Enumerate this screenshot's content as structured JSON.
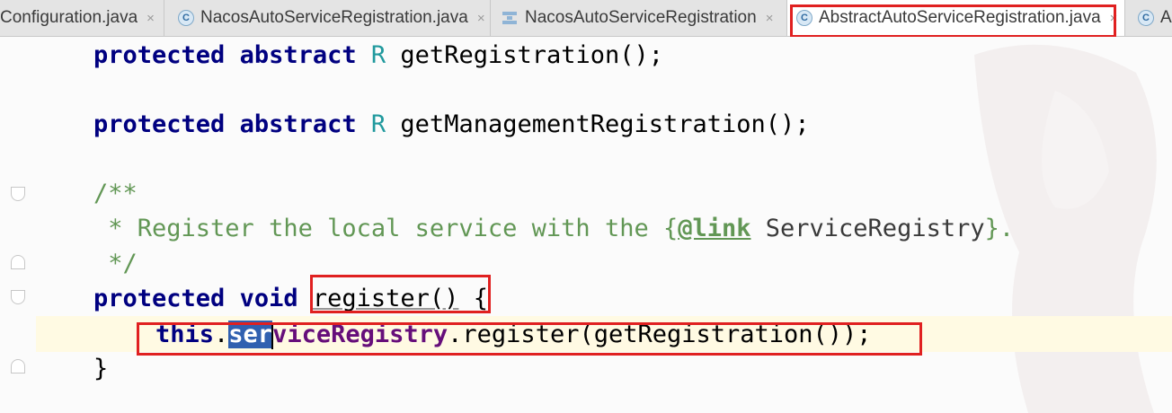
{
  "tabs": [
    {
      "label": "Configuration.java",
      "icon": "class-icon",
      "active": false
    },
    {
      "label": "NacosAutoServiceRegistration.java",
      "icon": "class-icon",
      "active": false
    },
    {
      "label": "NacosAutoServiceRegistration",
      "icon": "diagram-icon",
      "active": false
    },
    {
      "label": "AbstractAutoServiceRegistration.java",
      "icon": "class-icon",
      "active": true
    },
    {
      "label": "A",
      "icon": "class-icon",
      "active": false
    }
  ],
  "tab_close_glyph": "×",
  "class_icon_letter": "C",
  "code": {
    "line1": {
      "kw1": "protected",
      "kw2": "abstract",
      "type": "R",
      "rest": "getRegistration();"
    },
    "line2": {
      "kw1": "protected",
      "kw2": "abstract",
      "type": "R",
      "rest": "getManagementRegistration();"
    },
    "line3": {
      "text": "/**"
    },
    "line4": {
      "prefix": " * Register the local service with the {",
      "tag": "@link",
      "ref": "ServiceRegistry",
      "suffix": "}."
    },
    "line5": {
      "text": " */"
    },
    "line6": {
      "kw1": "protected",
      "kw2": "void",
      "method": "register()",
      "brace": "{"
    },
    "line7": {
      "kw": "this",
      "dot": ".",
      "selected": "ser",
      "field_rest": "viceRegistry",
      "rest": ".register(getRegistration());"
    },
    "line8": {
      "text": "}"
    }
  },
  "colors": {
    "keyword": "#000080",
    "type_param": "#20999d",
    "comment": "#629755",
    "field": "#660e7a",
    "selection": "#3060b0",
    "highlight_box": "#e02020"
  }
}
